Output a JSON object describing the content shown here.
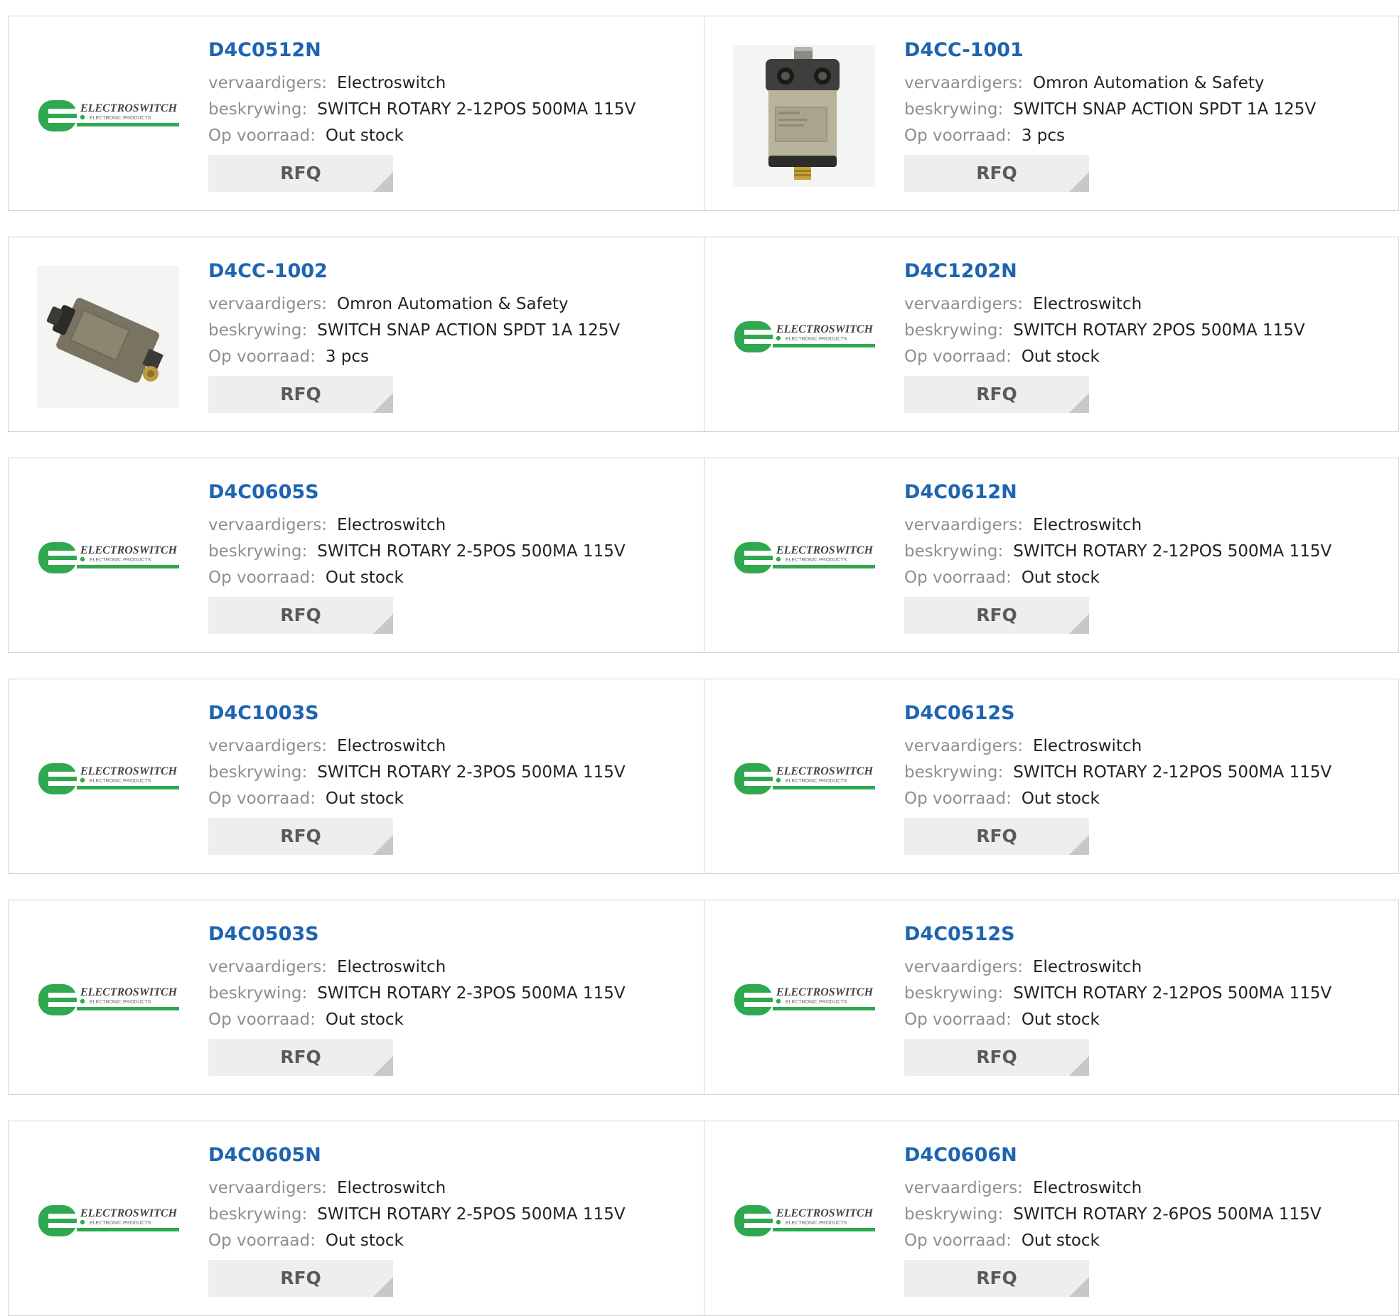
{
  "labels": {
    "manufacturer": "vervaardigers:",
    "description": "beskrywing:",
    "stock": "Op voorraad:",
    "rfq": "RFQ"
  },
  "logo": {
    "brand": "ELECTROSWITCH",
    "tagline": "ELECTRONIC PRODUCTS",
    "green": "#2fa84f"
  },
  "colors": {
    "part_link": "#1e64b0",
    "label": "#8f8f8f",
    "rfq_bg": "#eeeeee",
    "border": "#d2d2d2"
  },
  "products": [
    {
      "part": "D4C0512N",
      "manufacturer": "Electroswitch",
      "description": "SWITCH ROTARY 2-12POS 500MA 115V",
      "stock": "Out stock",
      "image": "electroswitch-logo"
    },
    {
      "part": "D4CC-1001",
      "manufacturer": "Omron Automation & Safety",
      "description": "SWITCH SNAP ACTION SPDT 1A 125V",
      "stock": "3 pcs",
      "image": "limit-switch-front"
    },
    {
      "part": "D4CC-1002",
      "manufacturer": "Omron Automation & Safety",
      "description": "SWITCH SNAP ACTION SPDT 1A 125V",
      "stock": "3 pcs",
      "image": "limit-switch-side"
    },
    {
      "part": "D4C1202N",
      "manufacturer": "Electroswitch",
      "description": "SWITCH ROTARY 2POS 500MA 115V",
      "stock": "Out stock",
      "image": "electroswitch-logo"
    },
    {
      "part": "D4C0605S",
      "manufacturer": "Electroswitch",
      "description": "SWITCH ROTARY 2-5POS 500MA 115V",
      "stock": "Out stock",
      "image": "electroswitch-logo"
    },
    {
      "part": "D4C0612N",
      "manufacturer": "Electroswitch",
      "description": "SWITCH ROTARY 2-12POS 500MA 115V",
      "stock": "Out stock",
      "image": "electroswitch-logo"
    },
    {
      "part": "D4C1003S",
      "manufacturer": "Electroswitch",
      "description": "SWITCH ROTARY 2-3POS 500MA 115V",
      "stock": "Out stock",
      "image": "electroswitch-logo"
    },
    {
      "part": "D4C0612S",
      "manufacturer": "Electroswitch",
      "description": "SWITCH ROTARY 2-12POS 500MA 115V",
      "stock": "Out stock",
      "image": "electroswitch-logo"
    },
    {
      "part": "D4C0503S",
      "manufacturer": "Electroswitch",
      "description": "SWITCH ROTARY 2-3POS 500MA 115V",
      "stock": "Out stock",
      "image": "electroswitch-logo"
    },
    {
      "part": "D4C0512S",
      "manufacturer": "Electroswitch",
      "description": "SWITCH ROTARY 2-12POS 500MA 115V",
      "stock": "Out stock",
      "image": "electroswitch-logo"
    },
    {
      "part": "D4C0605N",
      "manufacturer": "Electroswitch",
      "description": "SWITCH ROTARY 2-5POS 500MA 115V",
      "stock": "Out stock",
      "image": "electroswitch-logo"
    },
    {
      "part": "D4C0606N",
      "manufacturer": "Electroswitch",
      "description": "SWITCH ROTARY 2-6POS 500MA 115V",
      "stock": "Out stock",
      "image": "electroswitch-logo"
    }
  ]
}
